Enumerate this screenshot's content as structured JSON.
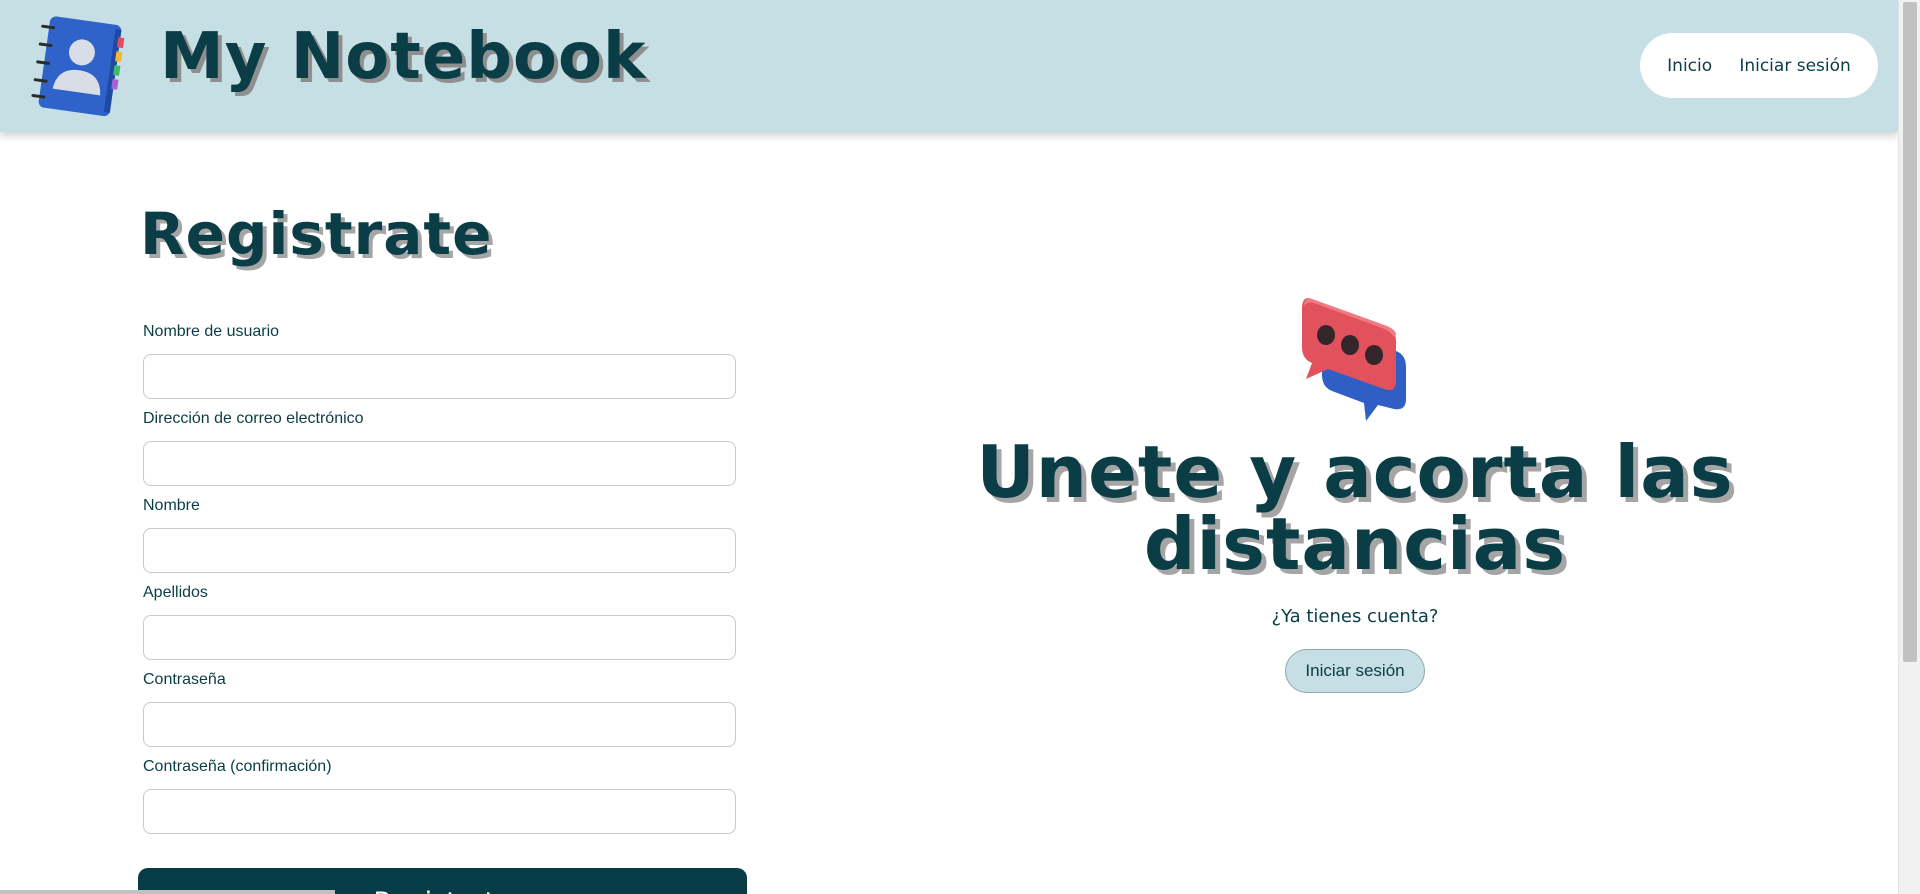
{
  "header": {
    "brand": "My Notebook",
    "nav": [
      {
        "label": "Inicio"
      },
      {
        "label": "Iniciar sesión"
      }
    ]
  },
  "form": {
    "title": "Registrate",
    "fields": [
      {
        "label": "Nombre de usuario",
        "value": ""
      },
      {
        "label": "Dirección de correo electrónico",
        "value": ""
      },
      {
        "label": "Nombre",
        "value": ""
      },
      {
        "label": "Apellidos",
        "value": ""
      },
      {
        "label": "Contraseña",
        "value": ""
      },
      {
        "label": "Contraseña (confirmación)",
        "value": ""
      }
    ],
    "submit_label": "Registrate"
  },
  "promo": {
    "heading": "Unete y acorta las distancias",
    "question": "¿Ya tienes cuenta?",
    "login_label": "Iniciar sesión"
  },
  "icons": {
    "brand": "notebook-contact-icon",
    "promo": "chat-bubble-icon"
  },
  "colors": {
    "navbar_bg": "#c5dfe4",
    "text_primary": "#0a3d46",
    "submit_bg": "#073b45",
    "chat_red": "#e2525c",
    "chat_blue": "#2f5fc4"
  }
}
